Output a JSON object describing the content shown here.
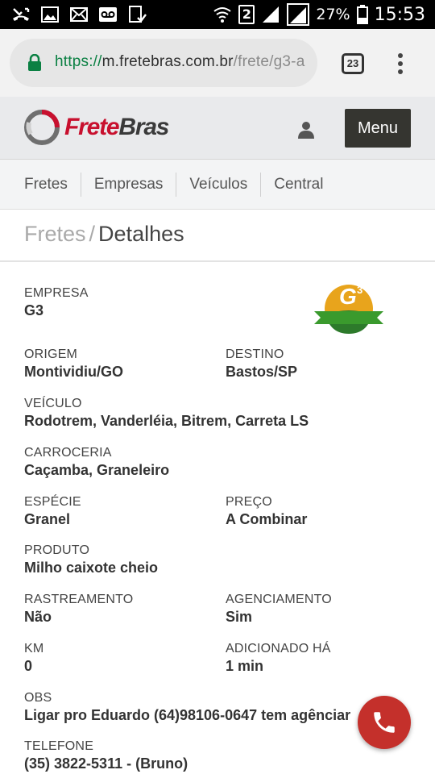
{
  "status_bar": {
    "battery_percent": "27%",
    "time": "15:53",
    "sim_badge": "2",
    "left_icons": [
      "missed-call-icon",
      "image-icon",
      "mail-icon",
      "voicemail-icon",
      "download-icon"
    ],
    "right_icons": [
      "wifi-icon",
      "signal-icon",
      "signal-icon-2",
      "battery-icon"
    ]
  },
  "browser": {
    "url_scheme": "https://",
    "url_host": "m.fretebras.com.br",
    "url_path": "/frete/g3-a",
    "tab_count": "23"
  },
  "header": {
    "logo_part1": "Frete",
    "logo_part2": "Bras",
    "menu_label": "Menu"
  },
  "nav": {
    "items": [
      "Fretes",
      "Empresas",
      "Veículos",
      "Central"
    ]
  },
  "breadcrumb": {
    "parent": "Fretes",
    "separator": "/",
    "current": "Detalhes"
  },
  "details": {
    "empresa": {
      "label": "EMPRESA",
      "value": "G3"
    },
    "origem": {
      "label": "ORIGEM",
      "value": "Montividiu/GO"
    },
    "destino": {
      "label": "DESTINO",
      "value": "Bastos/SP"
    },
    "veiculo": {
      "label": "VEÍCULO",
      "value": "Rodotrem, Vanderléia, Bitrem, Carreta LS"
    },
    "carroceria": {
      "label": "CARROCERIA",
      "value": "Caçamba, Graneleiro"
    },
    "especie": {
      "label": "ESPÉCIE",
      "value": "Granel"
    },
    "preco": {
      "label": "PREÇO",
      "value": "A Combinar"
    },
    "produto": {
      "label": "PRODUTO",
      "value": "Milho caixote cheio"
    },
    "rastreamento": {
      "label": "RASTREAMENTO",
      "value": "Não"
    },
    "agenciamento": {
      "label": "AGENCIAMENTO",
      "value": "Sim"
    },
    "km": {
      "label": "KM",
      "value": "0"
    },
    "adicionado": {
      "label": "ADICIONADO HÁ",
      "value": "1 min"
    },
    "obs": {
      "label": "OBS",
      "value": "Ligar pro Eduardo (64)98106-0647 tem agênciar"
    },
    "telefone": {
      "label": "TELEFONE",
      "value": "(35) 3822-5311 - (Bruno)"
    }
  },
  "company_logo": {
    "text": "G",
    "superscript": "3"
  },
  "colors": {
    "brand_red": "#c8102e",
    "call_button": "#c4302b",
    "menu_button": "#353530",
    "url_secure_green": "#0b8043"
  }
}
